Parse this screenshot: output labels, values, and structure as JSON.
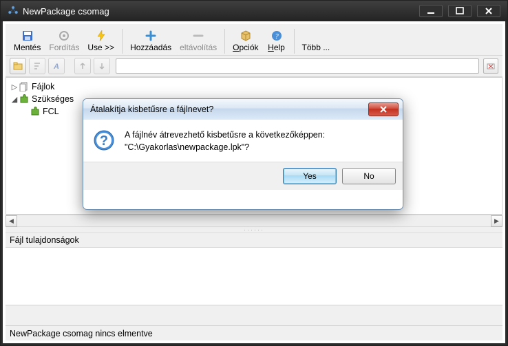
{
  "window": {
    "title": "NewPackage csomag"
  },
  "toolbar": {
    "save": "Mentés",
    "compile": "Fordítás",
    "use": "Use >>",
    "add": "Hozzáadás",
    "remove": "eltávolítás",
    "options": "Opciók",
    "help": "Help",
    "more": "Több ..."
  },
  "tree": {
    "files": "Fájlok",
    "required": "Szükséges",
    "fcl": "FCL"
  },
  "props": {
    "header": "Fájl tulajdonságok"
  },
  "status": {
    "text": "NewPackage csomag nincs elmentve"
  },
  "dialog": {
    "title": "Átalakítja kisbetűsre a fájlnevet?",
    "line1": "A fájlnév átrevezhető kisbetűsre a következőképpen:",
    "line2": "\"C:\\Gyakorlas\\newpackage.lpk\"?",
    "yes": "Yes",
    "no": "No"
  }
}
